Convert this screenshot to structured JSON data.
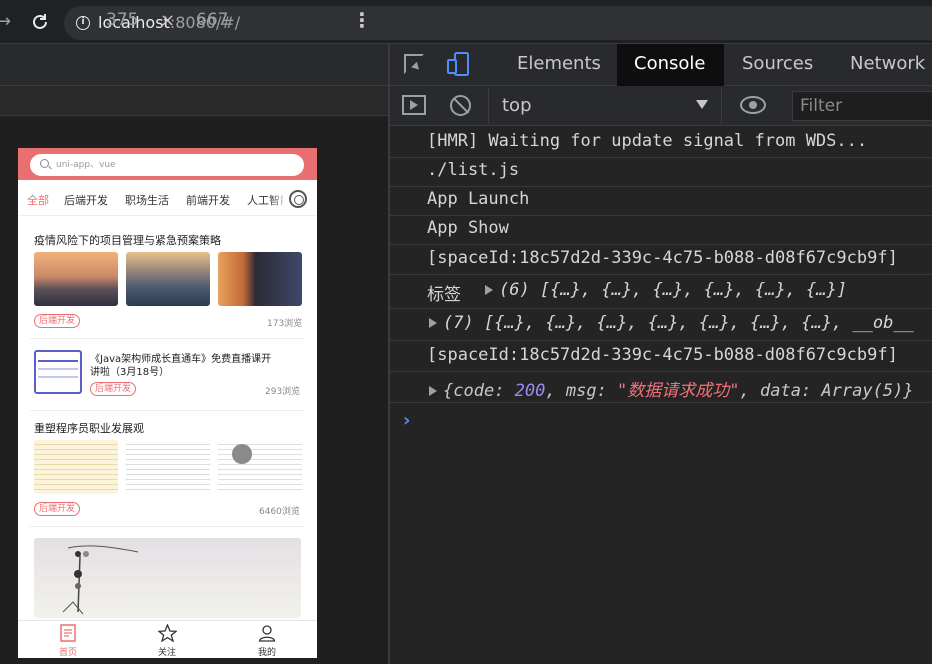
{
  "browser": {
    "forward_icon": "→",
    "url_host": "localhost",
    "url_rest": ":8080/#/"
  },
  "device": {
    "width": "375",
    "times": "×",
    "height": "667",
    "more": "⋮"
  },
  "app": {
    "search_placeholder": "uni-app、vue",
    "tabs": [
      "全部",
      "后端开发",
      "职场生活",
      "前端开发",
      "人工智能"
    ],
    "cards": [
      {
        "title": "疫情风险下的项目管理与紧急预案策略",
        "tag": "后端开发",
        "views": "173浏览"
      },
      {
        "title": "《Java架构师成长直通车》免费直播课开讲啦（3月18号）",
        "title_line1": "《Java架构师成长直通车》免费直播课开",
        "title_line2": "讲啦（3月18号）",
        "tag": "后端开发",
        "views": "293浏览"
      },
      {
        "title": "重塑程序员职业发展观",
        "tag": "后端开发",
        "views": "6460浏览"
      }
    ],
    "tabbar": [
      "首页",
      "关注",
      "我的"
    ],
    "accent_color": "#ea6f71"
  },
  "devtools": {
    "tabs": [
      "Elements",
      "Console",
      "Sources",
      "Network"
    ],
    "context": "top",
    "filter_placeholder": "Filter",
    "logs": {
      "l1": "[HMR] Waiting for update signal from WDS...",
      "l2": "./list.js",
      "l3": "App Launch",
      "l4": "App Show",
      "l5": "[spaceId:18c57d2d-339c-4c75-b088-d08f67c9cb9f]",
      "l6_label": "标签",
      "l6_value": "(6) [{…}, {…}, {…}, {…}, {…}, {…}]",
      "l7_value": "(7) [{…}, {…}, {…}, {…}, {…}, {…}, {…}, __ob__",
      "l8": "[spaceId:18c57d2d-339c-4c75-b088-d08f67c9cb9f]",
      "l9_open": "{",
      "l9_code_key": "code: ",
      "l9_code_val": "200",
      "l9_msg_key": ", msg: ",
      "l9_msg_val": "\"数据请求成功\"",
      "l9_data": ", data: Array(5)}"
    },
    "prompt": "›"
  }
}
